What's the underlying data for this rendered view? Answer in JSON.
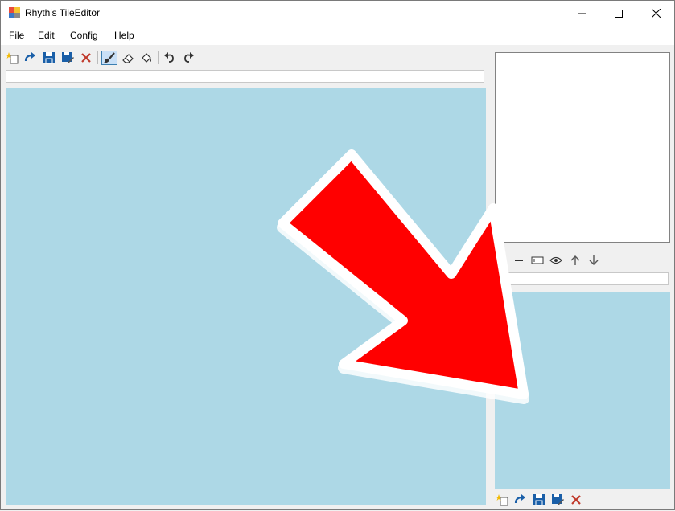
{
  "window": {
    "title": "Rhyth's TileEditor"
  },
  "menu": [
    "File",
    "Edit",
    "Config",
    "Help"
  ],
  "main_toolbar": {
    "buttons": [
      "new-icon",
      "redo-arrow-icon",
      "save-icon",
      "save-as-icon",
      "delete-icon",
      "brush-icon",
      "eraser-icon",
      "fill-bucket-icon",
      "undo-icon",
      "redo-icon"
    ]
  },
  "layer_toolbar": {
    "buttons": [
      "remove-icon",
      "rename-icon",
      "visibility-icon",
      "move-up-icon",
      "move-down-icon"
    ]
  },
  "tileset_toolbar": {
    "buttons": [
      "new-icon",
      "redo-arrow-icon",
      "save-icon",
      "save-as-icon",
      "delete-icon"
    ]
  },
  "colors": {
    "canvas": "#add8e6",
    "accent": "#1a5fa8",
    "delete": "#c0392b",
    "arrow": "#ff0000"
  }
}
